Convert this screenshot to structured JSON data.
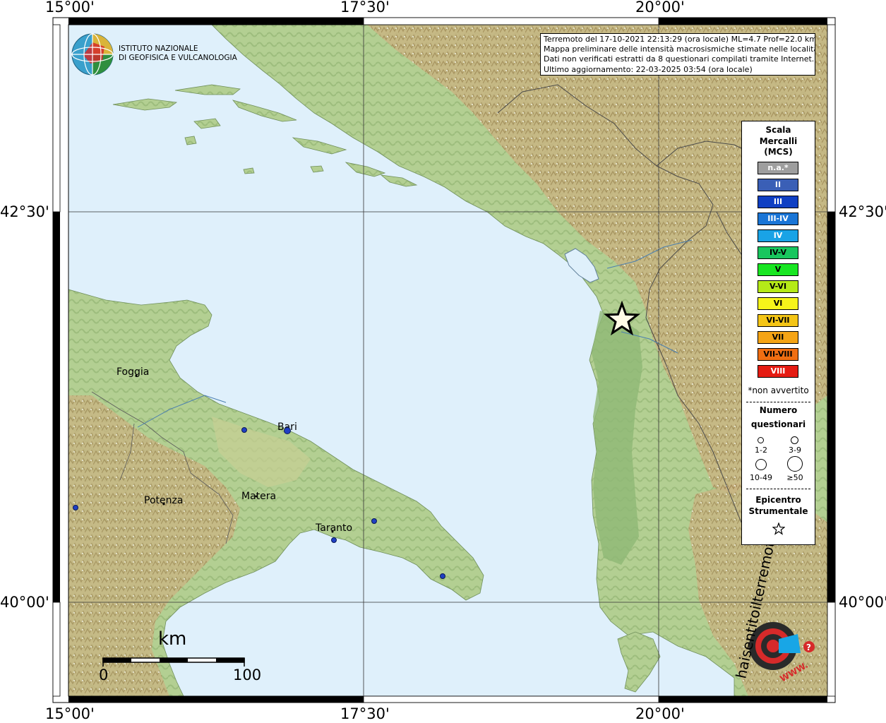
{
  "map": {
    "axes": {
      "top": [
        "15°00'",
        "17°30'",
        "20°00'"
      ],
      "bottom": [
        "15°00'",
        "17°30'",
        "20°00'"
      ],
      "left": [
        "42°30'",
        "40°00'"
      ],
      "right": [
        "42°30'",
        "40°00'"
      ]
    },
    "cities": [
      "Foggia",
      "Bari",
      "Potenza",
      "Matera",
      "Taranto"
    ],
    "scale_bar": {
      "unit": "km",
      "start": "0",
      "end": "100"
    },
    "colors": {
      "sea": "#dff0fb",
      "land": "#a9c98a",
      "epicenter_fill": "#fffbe6",
      "dot": "#1f3fc4"
    }
  },
  "info_box": {
    "lines": [
      "Terremoto del 17-10-2021 22:13:29 (ora locale) ML=4.7 Prof=22.0 km",
      "Mappa preliminare delle intensità macrosismiche stimate nelle località.",
      "Dati non verificati estratti da 8 questionari compilati tramite Internet.",
      "Ultimo aggiornamento: 22-03-2025 03:54 (ora locale)"
    ]
  },
  "institute": {
    "line1": "ISTITUTO NAZIONALE",
    "line2": "DI GEOFISICA E VULCANOLOGIA"
  },
  "legend": {
    "title": [
      "Scala",
      "Mercalli",
      "(MCS)"
    ],
    "intensities": [
      {
        "label": "n.a.*",
        "color": "#9e9e9e",
        "text": "#ffffff"
      },
      {
        "label": "II",
        "color": "#3a5fb6",
        "text": "#ffffff"
      },
      {
        "label": "III",
        "color": "#0f3fc3",
        "text": "#ffffff"
      },
      {
        "label": "III-IV",
        "color": "#1a75d6",
        "text": "#ffffff"
      },
      {
        "label": "IV",
        "color": "#19a3e6",
        "text": "#ffffff"
      },
      {
        "label": "IV-V",
        "color": "#18c65e",
        "text": "#000000"
      },
      {
        "label": "V",
        "color": "#18e622",
        "text": "#000000"
      },
      {
        "label": "V-VI",
        "color": "#b5ea18",
        "text": "#000000"
      },
      {
        "label": "VI",
        "color": "#f6f41a",
        "text": "#000000"
      },
      {
        "label": "VI-VII",
        "color": "#f4c516",
        "text": "#000000"
      },
      {
        "label": "VII",
        "color": "#f5a415",
        "text": "#000000"
      },
      {
        "label": "VII-VIII",
        "color": "#f06e12",
        "text": "#000000"
      },
      {
        "label": "VIII",
        "color": "#e51b12",
        "text": "#ffffff"
      }
    ],
    "not_felt_note": "*non avvertito",
    "questionnaires_title": [
      "Numero",
      "questionari"
    ],
    "size_classes": [
      "1-2",
      "3-9",
      "10-49",
      "≥50"
    ],
    "epicenter_title": [
      "Epicentro",
      "Strumentale"
    ]
  },
  "hsit_logo": {
    "text": "haisentitoilterremoto.it",
    "url_text": "WWW."
  }
}
